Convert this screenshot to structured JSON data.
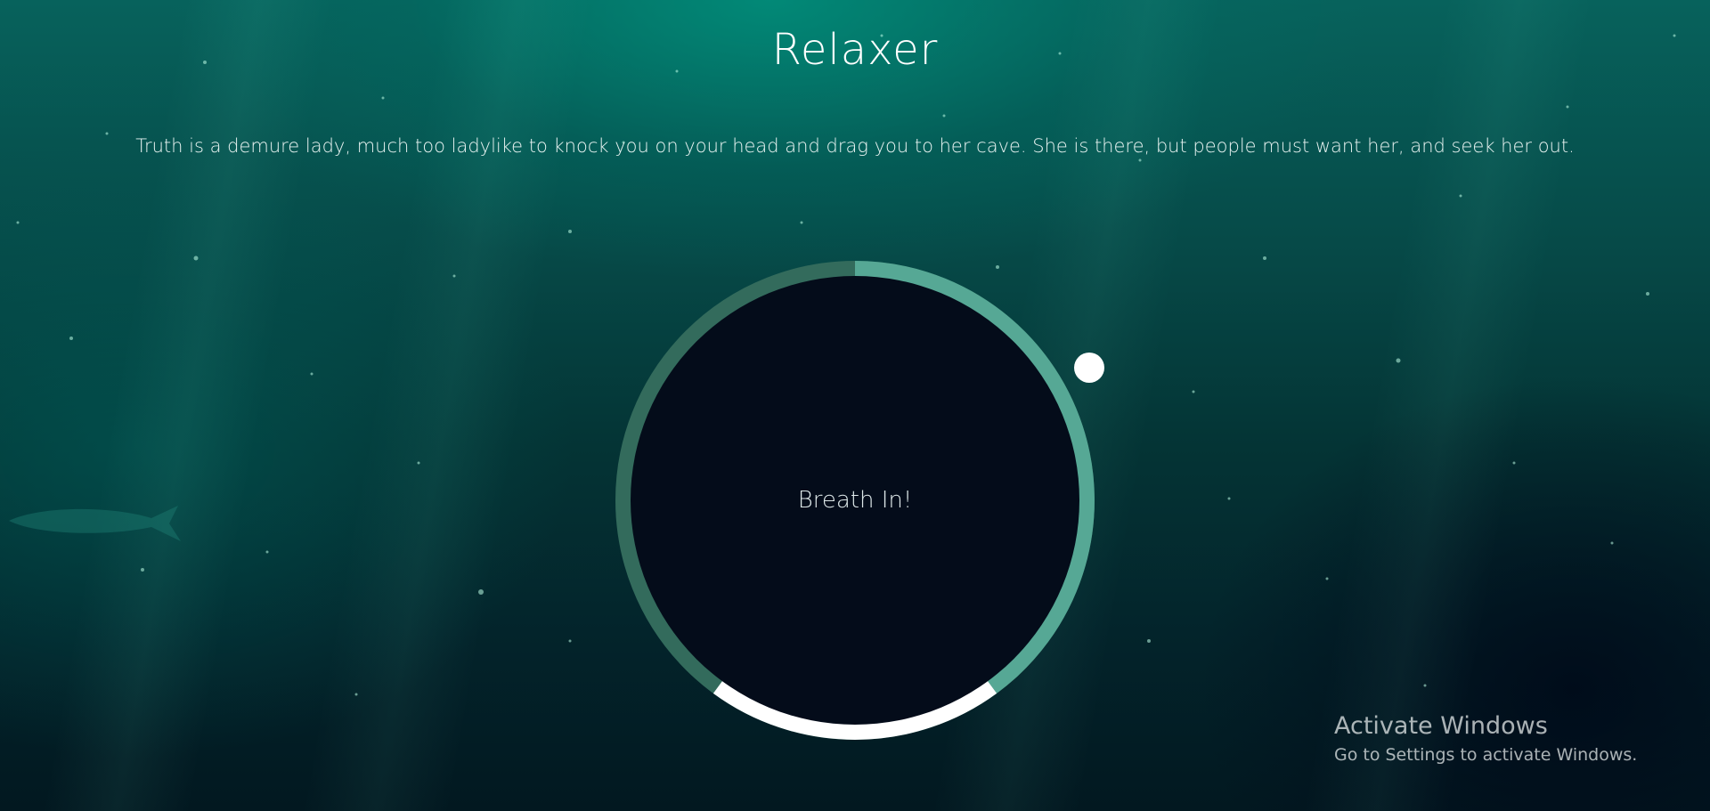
{
  "page": {
    "title": "Relaxer",
    "quote": "Truth is a demure lady, much too ladylike to knock you on your head and drag you to her cave. She is there, but people must want her, and seek her out."
  },
  "breath": {
    "status_text": "Breath In!",
    "colors": {
      "ring_dark": "#336b5c",
      "ring_light": "#56a895",
      "ring_white": "#ffffff",
      "inner": "#040c1a",
      "pointer": "#ffffff"
    }
  },
  "watermark": {
    "title": "Activate Windows",
    "subtitle": "Go to Settings to activate Windows."
  }
}
